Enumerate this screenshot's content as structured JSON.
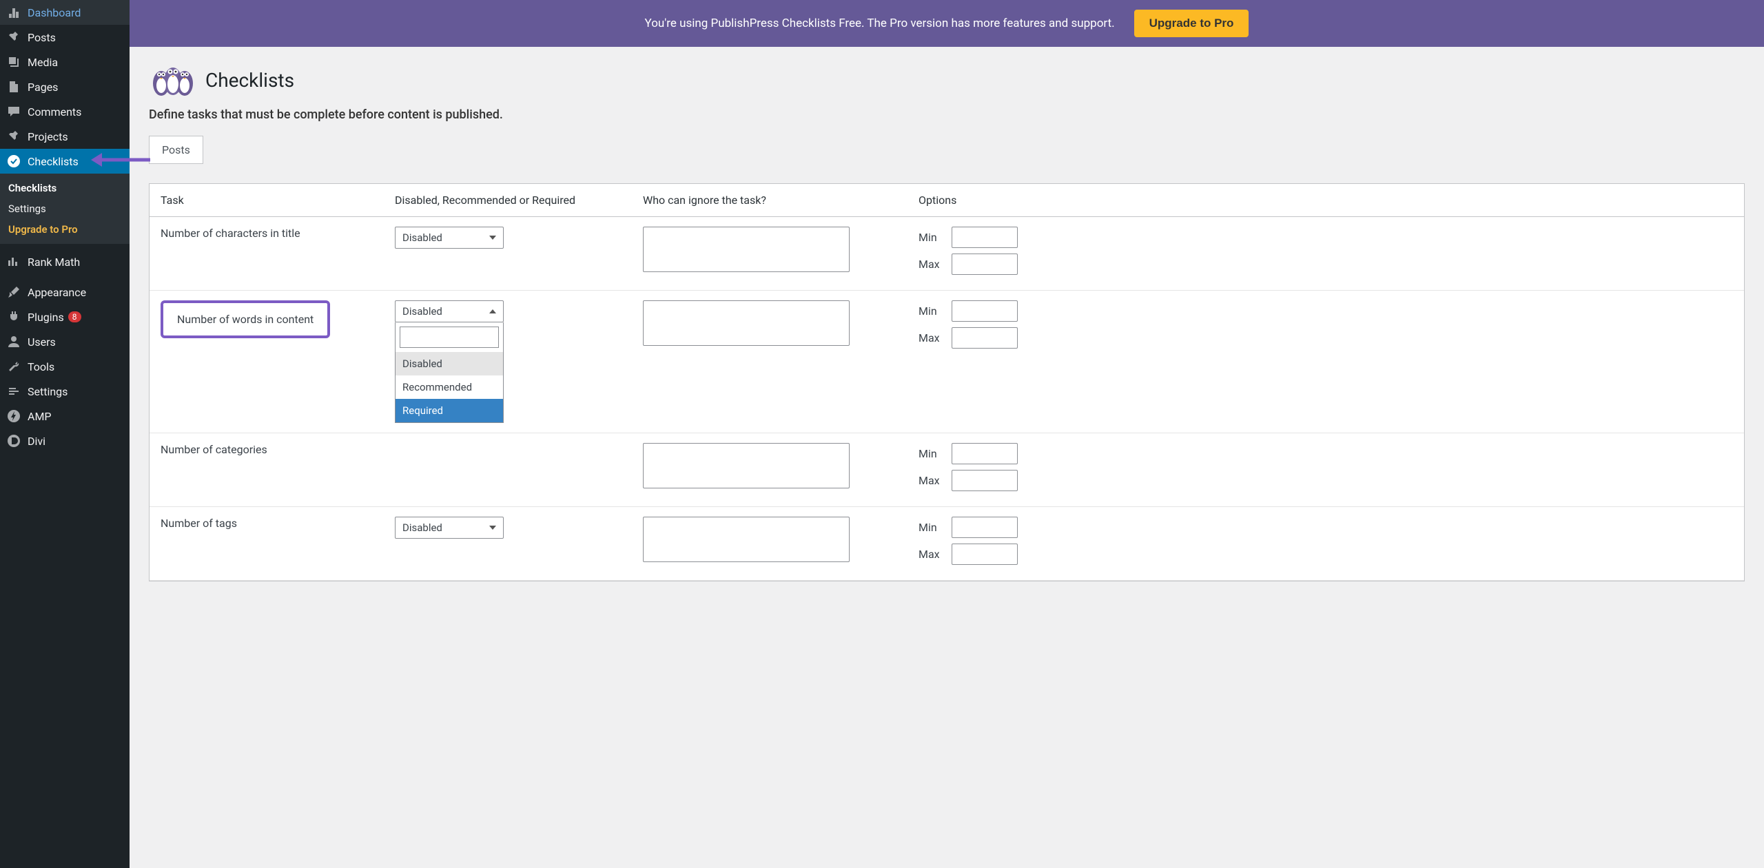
{
  "sidebar": {
    "items": [
      {
        "label": "Dashboard",
        "icon": "dashboard"
      },
      {
        "label": "Posts",
        "icon": "pin"
      },
      {
        "label": "Media",
        "icon": "media"
      },
      {
        "label": "Pages",
        "icon": "page"
      },
      {
        "label": "Comments",
        "icon": "comment"
      },
      {
        "label": "Projects",
        "icon": "pin"
      },
      {
        "label": "Checklists",
        "icon": "check",
        "active": true
      },
      {
        "label": "Rank Math",
        "icon": "chart"
      },
      {
        "label": "Appearance",
        "icon": "brush"
      },
      {
        "label": "Plugins",
        "icon": "plug",
        "badge": "8"
      },
      {
        "label": "Users",
        "icon": "user"
      },
      {
        "label": "Tools",
        "icon": "wrench"
      },
      {
        "label": "Settings",
        "icon": "sliders"
      },
      {
        "label": "AMP",
        "icon": "amp"
      },
      {
        "label": "Divi",
        "icon": "divi"
      }
    ],
    "sub": [
      {
        "label": "Checklists",
        "current": true
      },
      {
        "label": "Settings"
      },
      {
        "label": "Upgrade to Pro",
        "upgrade": true
      }
    ]
  },
  "banner": {
    "text": "You're using PublishPress Checklists Free. The Pro version has more features and support.",
    "button": "Upgrade to Pro"
  },
  "page": {
    "title": "Checklists",
    "desc": "Define tasks that must be complete before content is published."
  },
  "tabs": {
    "posts": "Posts"
  },
  "table": {
    "headers": {
      "task": "Task",
      "status": "Disabled, Recommended or Required",
      "ignore": "Who can ignore the task?",
      "options": "Options"
    },
    "labels": {
      "min": "Min",
      "max": "Max"
    },
    "select": {
      "disabled": "Disabled",
      "recommended": "Recommended",
      "required": "Required"
    },
    "rows": [
      {
        "task": "Number of characters in title",
        "status": "Disabled"
      },
      {
        "task": "Number of words in content",
        "status": "Disabled",
        "highlighted": true,
        "open": true
      },
      {
        "task": "Number of categories",
        "status": ""
      },
      {
        "task": "Number of tags",
        "status": "Disabled"
      }
    ]
  }
}
